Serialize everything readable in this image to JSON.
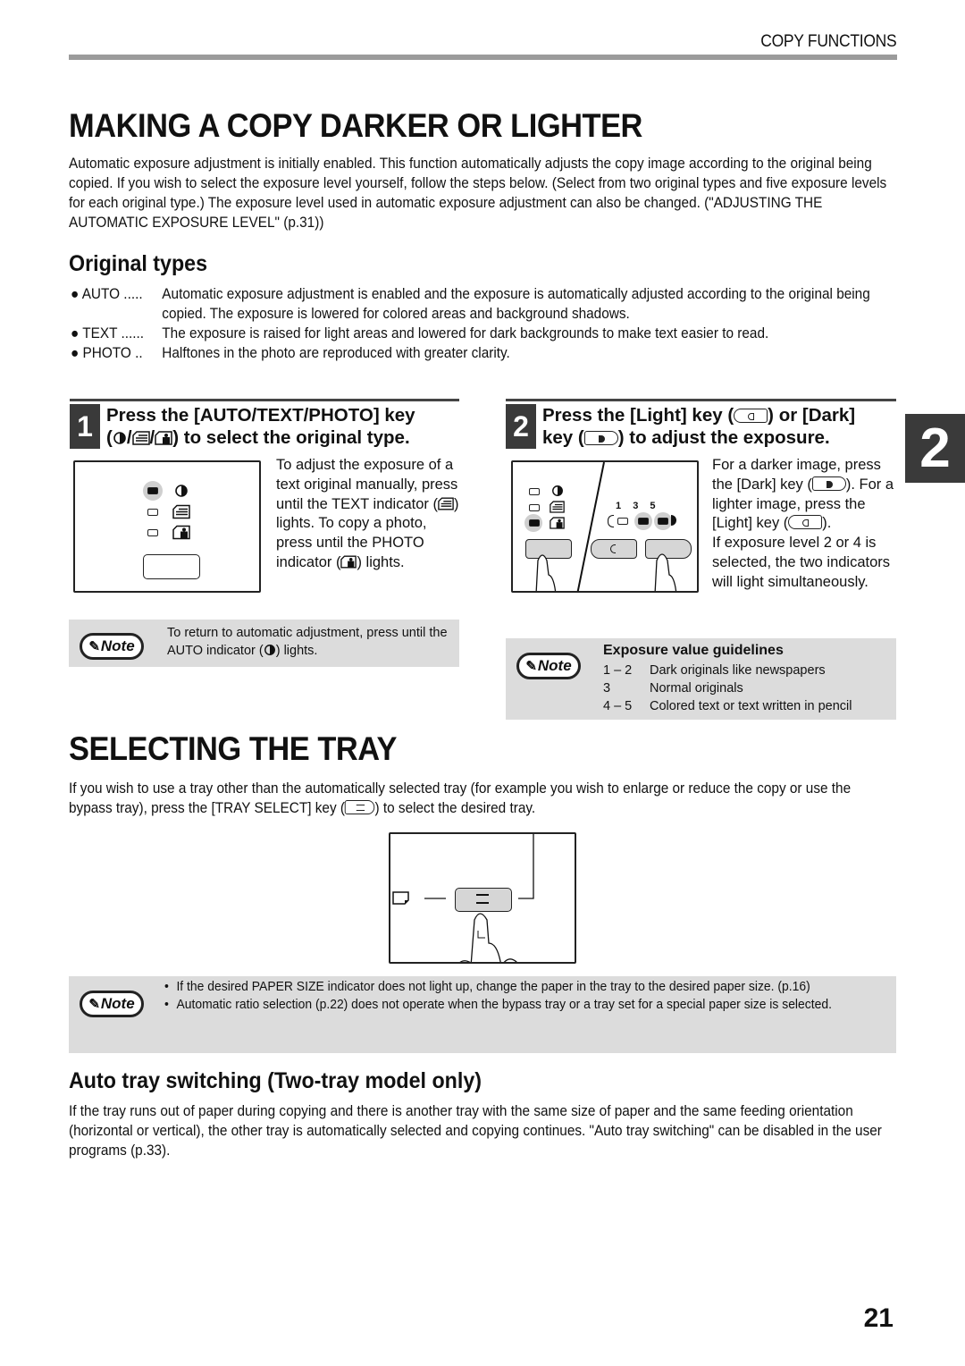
{
  "header": {
    "section_label": "COPY FUNCTIONS"
  },
  "chapter_tab": "2",
  "page_number": "21",
  "darker_lighter": {
    "title": "MAKING A COPY DARKER OR LIGHTER",
    "intro": "Automatic exposure adjustment is initially enabled. This function automatically adjusts the copy image according to the original being copied. If you wish to select the exposure level yourself, follow the steps below. (Select from two original types and five exposure levels for each original type.) The exposure level used in automatic exposure adjustment can also be changed. (\"ADJUSTING THE AUTOMATIC EXPOSURE LEVEL\" (p.31))",
    "original_types": {
      "heading": "Original types",
      "items": [
        {
          "key": "AUTO .....",
          "desc": "Automatic exposure adjustment is enabled and the exposure is automatically adjusted according to the original being copied. The exposure is lowered for colored areas and background shadows."
        },
        {
          "key": "TEXT ......",
          "desc": "The exposure is raised for light areas and lowered for dark backgrounds to make text easier to read."
        },
        {
          "key": "PHOTO ..",
          "desc": "Halftones in the photo are reproduced with greater clarity."
        }
      ]
    },
    "step1": {
      "number": "1",
      "line1": "Press the [AUTO/TEXT/PHOTO] key",
      "line2_prefix": "(",
      "line2_suffix": ") to select the original type.",
      "text_a": "To adjust the exposure of a text original manually, press until the TEXT indicator (",
      "text_b": ") lights. To copy a photo, press until the PHOTO indicator (",
      "text_c": ") lights.",
      "note": {
        "badge": "Note",
        "text_a": "To return to automatic adjustment, press until the AUTO indicator (",
        "text_b": ") lights."
      }
    },
    "step2": {
      "number": "2",
      "line1_a": "Press the [Light] key (",
      "line1_b": ") or [Dark]",
      "line2_a": "key (",
      "line2_b": ") to adjust the exposure.",
      "text_a": "For a darker image, press the [Dark] key (",
      "text_b": "). For a lighter image, press the [Light] key (",
      "text_c": ").",
      "text_d": "If exposure level 2 or 4 is selected, the two indicators will light simultaneously.",
      "panel_levels": [
        "1",
        "3",
        "5"
      ],
      "note": {
        "badge": "Note",
        "title": "Exposure value guidelines",
        "rows": [
          {
            "range": "1 – 2",
            "desc": "Dark originals like newspapers"
          },
          {
            "range": "3",
            "desc": "Normal originals"
          },
          {
            "range": "4 – 5",
            "desc": "Colored text or text written in pencil"
          }
        ]
      }
    }
  },
  "tray": {
    "title": "SELECTING THE TRAY",
    "intro_a": "If you wish to use a tray other than the automatically selected tray (for example you wish to enlarge or reduce the copy or use the bypass tray), press the [TRAY SELECT] key (",
    "intro_b": ") to select the desired tray.",
    "note": {
      "badge": "Note",
      "bullets": [
        "If the desired PAPER SIZE indicator does not light up, change the paper in the tray to the desired paper size. (p.16)",
        "Automatic ratio selection (p.22) does not operate when the bypass tray or a tray set for a special paper size is selected."
      ]
    },
    "auto_switching": {
      "heading": "Auto tray switching (Two-tray model only)",
      "text": "If the tray runs out of paper during copying and there is another tray with the same size of paper and the same feeding orientation (horizontal or vertical), the other tray is automatically selected and copying continues. \"Auto tray switching\" can be disabled in the user programs (p.33)."
    }
  },
  "icons": {
    "auto": "auto-exposure-icon",
    "text": "text-original-icon",
    "photo": "photo-original-icon",
    "light_key": "light-key-icon",
    "dark_key": "dark-key-icon",
    "tray_select": "tray-select-key-icon",
    "note": "note-pencil-icon"
  }
}
